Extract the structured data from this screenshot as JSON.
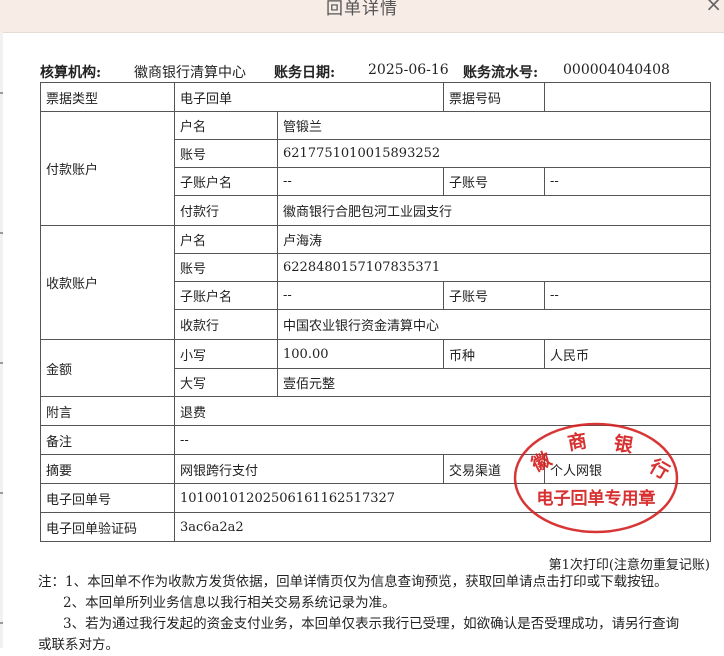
{
  "window": {
    "title": "回单详情",
    "close_symbol": "×"
  },
  "header": {
    "org_label": "核算机构:",
    "org_value": "徽商银行清算中心",
    "date_label": "账务日期:",
    "date_value": "2025-06-16",
    "serial_label": "账务流水号:",
    "serial_value": "000004040408"
  },
  "doc": {
    "type_label": "票据类型",
    "type_value": "电子回单",
    "number_label": "票据号码",
    "number_value": ""
  },
  "payer": {
    "section": "付款账户",
    "name_label": "户名",
    "name_value": "管锻兰",
    "account_label": "账号",
    "account_value": "6217751010015893252",
    "sub_name_label": "子账户名",
    "sub_name_value": "--",
    "sub_no_label": "子账号",
    "sub_no_value": "--",
    "bank_label": "付款行",
    "bank_value": "徽商银行合肥包河工业园支行"
  },
  "payee": {
    "section": "收款账户",
    "name_label": "户名",
    "name_value": "卢海涛",
    "account_label": "账号",
    "account_value": "6228480157107835371",
    "sub_name_label": "子账户名",
    "sub_name_value": "--",
    "sub_no_label": "子账号",
    "sub_no_value": "--",
    "bank_label": "收款行",
    "bank_value": "中国农业银行资金清算中心"
  },
  "amount": {
    "section": "金额",
    "small_label": "小写",
    "small_value": "100.00",
    "currency_label": "币种",
    "currency_value": "人民币",
    "big_label": "大写",
    "big_value": "壹佰元整"
  },
  "misc": {
    "postscript_label": "附言",
    "postscript_value": "退费",
    "remark_label": "备注",
    "remark_value": "--",
    "summary_label": "摘要",
    "summary_value": "网银跨行支付",
    "channel_label": "交易渠道",
    "channel_value": "个人网银",
    "receipt_no_label": "电子回单号",
    "receipt_no_value": "101001012025061611625173­27",
    "verify_label": "电子回单验证码",
    "verify_value": "3ac6a2a2"
  },
  "print_info": "第1次打印(注意勿重复记账)",
  "notes": [
    "注：1、本回单不作为收款方发货依据，回单详情页仅为信息查询预览，获取回单请点击打印或下载按钮。",
    "2、本回单所列业务信息以我行相关交易系统记录为准。",
    "3、若为通过我行发起的资金支付业务，本回单仅表示我行已受理，如欲确认是否受理成功，请另行查询",
    "或联系对方。"
  ],
  "stamp": {
    "top_text": "徽商银行",
    "bottom_text": "电子回单专用章",
    "color": "#d42020"
  }
}
